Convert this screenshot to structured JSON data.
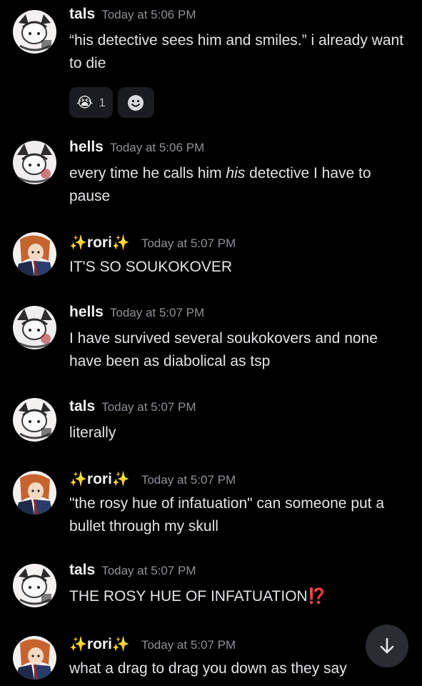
{
  "messages": [
    {
      "author": "tals",
      "avatar": "tals-avatar",
      "timestamp": "Today at 5:06 PM",
      "text": "“his detective sees him and smiles.” i already want to die",
      "reactions": [
        {
          "emoji": "😭",
          "count": "1"
        }
      ]
    },
    {
      "author": "hells",
      "avatar": "hells-avatar",
      "timestamp": "Today at 5:06 PM",
      "text_before": "every time he calls him ",
      "text_italic": "his",
      "text_after": " detective I have to pause"
    },
    {
      "author": "rori",
      "sparkle": "✨",
      "avatar": "rori-avatar",
      "timestamp": "Today at 5:07 PM",
      "text": "IT'S SO SOUKOKOVER"
    },
    {
      "author": "hells",
      "avatar": "hells-avatar",
      "timestamp": "Today at 5:07 PM",
      "text": "I have survived several soukokovers and none have been as diabolical as tsp"
    },
    {
      "author": "tals",
      "avatar": "tals-avatar",
      "timestamp": "Today at 5:07 PM",
      "text": "literally"
    },
    {
      "author": "rori",
      "sparkle": "✨",
      "avatar": "rori-avatar",
      "timestamp": "Today at 5:07 PM",
      "text": "\"the rosy hue of infatuation\" can someone put a bullet through my skull"
    },
    {
      "author": "tals",
      "avatar": "tals-avatar",
      "timestamp": "Today at 5:07 PM",
      "text": "THE ROSY HUE OF INFATUATION",
      "emoji": "⁉️"
    },
    {
      "author": "rori",
      "sparkle": "✨",
      "avatar": "rori-avatar",
      "timestamp": "Today at 5:07 PM",
      "text": "what a drag to drag you down as they say"
    }
  ],
  "icons": {
    "add_reaction": "smiley-add-reaction-icon",
    "scroll_down": "arrow-down-icon"
  },
  "colors": {
    "background": "#000000",
    "author": "#f2f3f5",
    "timestamp": "#8e9099",
    "reaction_bg": "#1b1c21",
    "scroll_button": "#2a2c33"
  }
}
